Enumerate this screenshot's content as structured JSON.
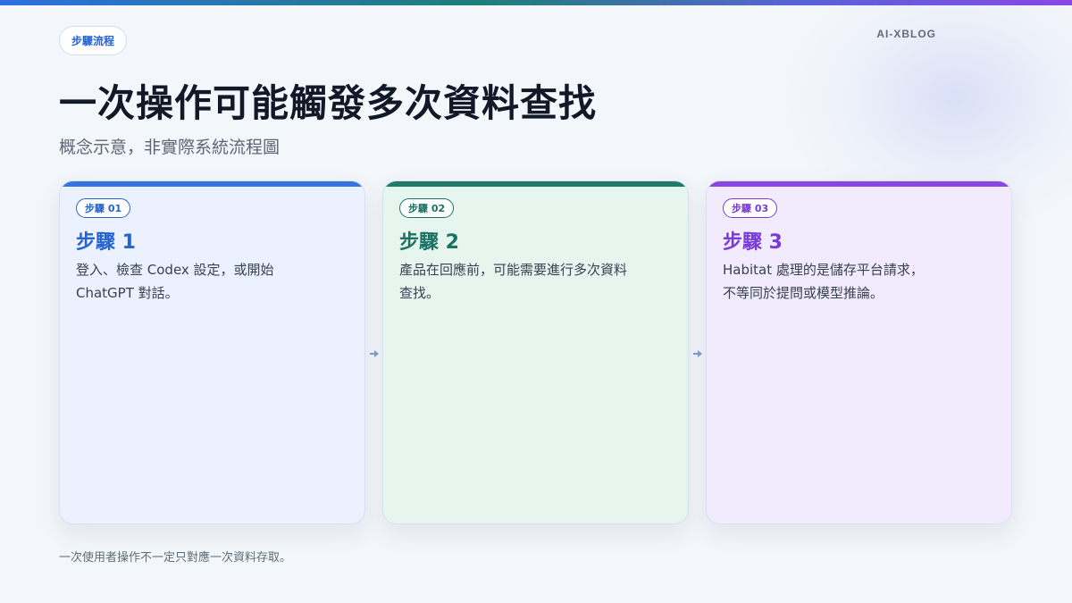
{
  "brand": "AI-XBLOG",
  "tag": "步驟流程",
  "title": "一次操作可能觸發多次資料查找",
  "subtitle": "概念示意，非實際系統流程圖",
  "steps": [
    {
      "badge": "步驟 01",
      "title": "步驟 1",
      "description": "登入、檢查 Codex 設定，或開始\nChatGPT 對話。",
      "accent_color": "#3574e2",
      "text_color": "#2563d0",
      "background": "#ebf1fe"
    },
    {
      "badge": "步驟 02",
      "title": "步驟 2",
      "description": "產品在回應前，可能需要進行多次資料\n查找。",
      "accent_color": "#1f7a6c",
      "text_color": "#1a7263",
      "background": "#e6f6ef"
    },
    {
      "badge": "步驟 03",
      "title": "步驟 3",
      "description": "Habitat 處理的是儲存平台請求，\n不等同於提問或模型推論。",
      "accent_color": "#8b45e4",
      "text_color": "#7a3ad6",
      "background": "#f2ebfd"
    }
  ],
  "arrow_icon": "arrow-right-icon",
  "footnote": "一次使用者操作不一定只對應一次資料存取。"
}
